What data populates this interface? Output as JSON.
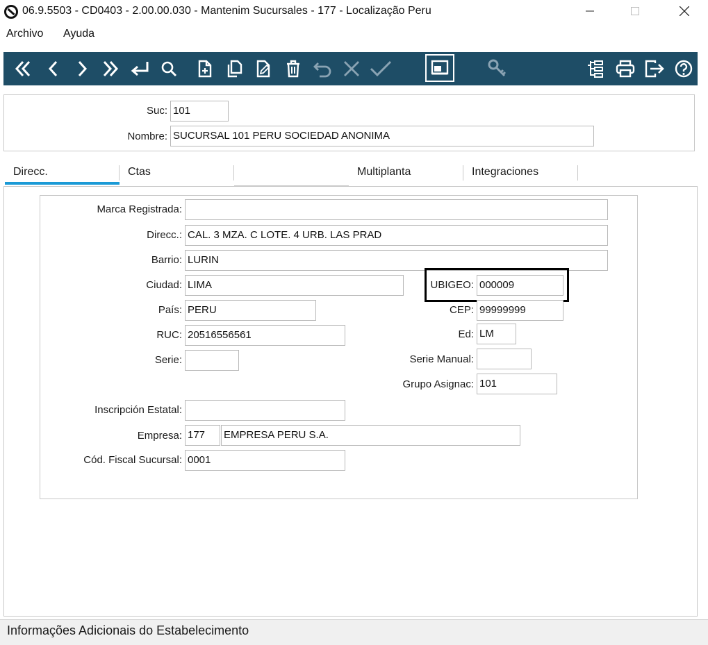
{
  "window": {
    "title": "06.9.5503 - CD0403 - 2.00.00.030 - Mantenim Sucursales - 177 - Localização Peru"
  },
  "menu": {
    "archivo": "Archivo",
    "ayuda": "Ayuda"
  },
  "toolbar": {
    "background": "#1e4d66",
    "icons": [
      "first-icon",
      "prev-icon",
      "next-icon",
      "last-icon",
      "goto-icon",
      "search-icon",
      "new-icon",
      "copy-icon",
      "edit-icon",
      "delete-icon",
      "undo-icon",
      "cancel-icon",
      "confirm-icon",
      "screen-icon",
      "key-icon",
      "tree-icon",
      "print-icon",
      "exit-icon",
      "help-icon"
    ]
  },
  "header": {
    "suc_label": "Suc:",
    "suc_value": "101",
    "nombre_label": "Nombre:",
    "nombre_value": "SUCURSAL 101 PERU SOCIEDAD ANONIMA"
  },
  "tabs": {
    "direcc": "Direcc.",
    "ctas": "Ctas",
    "multiplanta": "Multiplanta",
    "integraciones": "Integraciones",
    "active": "direcc",
    "active_color": "#1a9ad6"
  },
  "form": {
    "marca_label": "Marca Registrada:",
    "marca_value": "",
    "direcc_label": "Direcc.:",
    "direcc_value": "CAL. 3 MZA. C LOTE. 4 URB. LAS PRAD",
    "barrio_label": "Barrio:",
    "barrio_value": "LURIN",
    "ciudad_label": "Ciudad:",
    "ciudad_value": "LIMA",
    "ubigeo_label": "UBIGEO:",
    "ubigeo_value": "000009",
    "pais_label": "País:",
    "pais_value": "PERU",
    "cep_label": "CEP:",
    "cep_value": "99999999",
    "ruc_label": "RUC:",
    "ruc_value": "20516556561",
    "ed_label": "Ed:",
    "ed_value": "LM",
    "serie_label": "Serie:",
    "serie_value": "",
    "serie_manual_label": "Serie Manual:",
    "serie_manual_value": "",
    "grupo_label": "Grupo Asignac:",
    "grupo_value": "101",
    "inscripcion_label": "Inscripción Estatal:",
    "inscripcion_value": "",
    "empresa_label": "Empresa:",
    "empresa_code": "177",
    "empresa_name": "EMPRESA PERU S.A.",
    "cod_fiscal_label": "Cód. Fiscal Sucursal:",
    "cod_fiscal_value": "0001"
  },
  "status": {
    "text": "Informações Adicionais do Estabelecimento"
  }
}
